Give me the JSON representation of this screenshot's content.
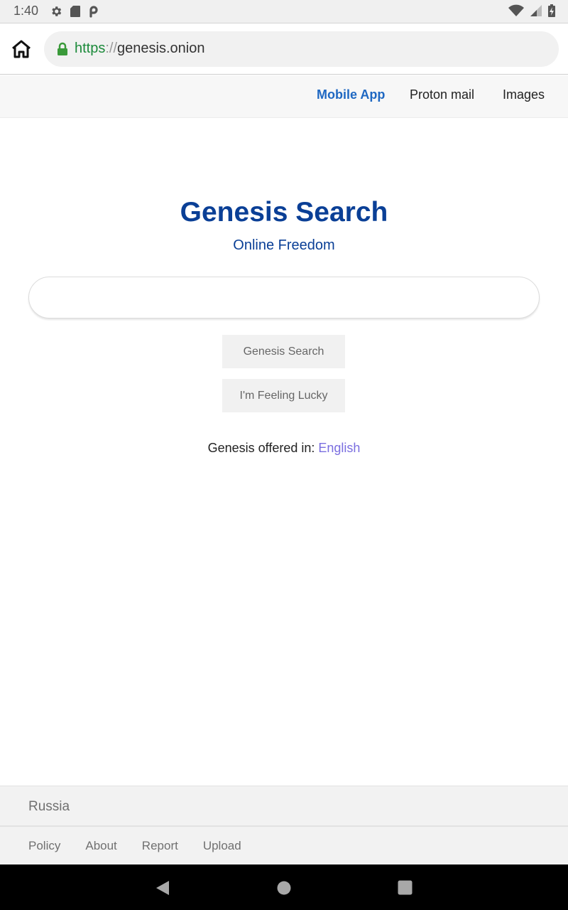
{
  "status_bar": {
    "time": "1:40",
    "left_icons": [
      "settings-icon",
      "sd-card-icon",
      "p-app-icon"
    ],
    "right_icons": [
      "wifi-icon",
      "cell-signal-icon",
      "battery-charging-icon"
    ]
  },
  "browser": {
    "url_scheme": "https",
    "url_separator": "://",
    "url_host": "genesis.onion",
    "secure": true
  },
  "nav": {
    "links": [
      {
        "label": "Mobile App",
        "active": true
      },
      {
        "label": "Proton mail",
        "active": false
      },
      {
        "label": "Images",
        "active": false
      }
    ]
  },
  "hero": {
    "title": "Genesis Search",
    "subtitle": "Online Freedom"
  },
  "search": {
    "value": "",
    "placeholder": ""
  },
  "buttons": {
    "search_label": "Genesis Search",
    "lucky_label": "I'm Feeling Lucky"
  },
  "language": {
    "prefix": "Genesis offered in: ",
    "link": "English"
  },
  "footer": {
    "country": "Russia",
    "links": [
      "Policy",
      "About",
      "Report",
      "Upload"
    ]
  },
  "colors": {
    "brand_blue": "#0a3f96",
    "active_nav": "#1f68c2",
    "language_link": "#7a6ee0",
    "secure_green": "#1b8a3a"
  }
}
